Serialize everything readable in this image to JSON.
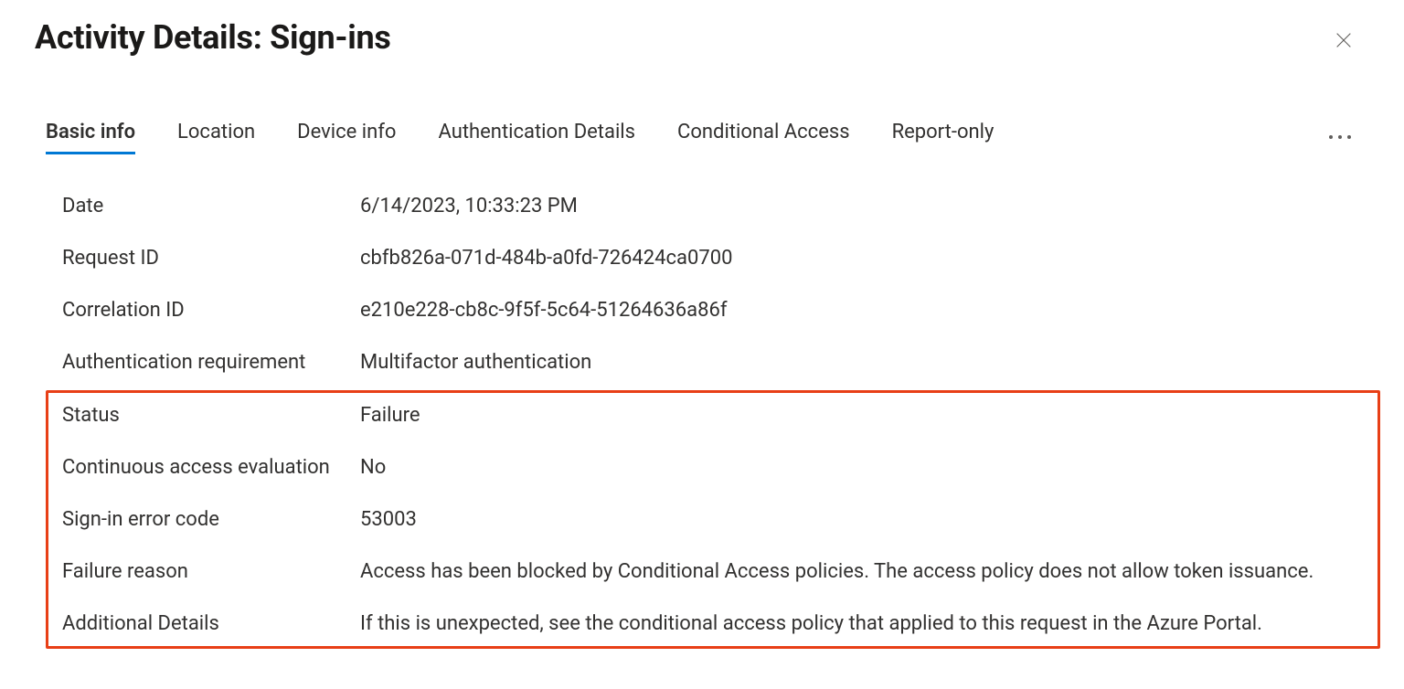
{
  "header": {
    "title": "Activity Details: Sign-ins"
  },
  "tabs": [
    {
      "label": "Basic info",
      "active": true
    },
    {
      "label": "Location",
      "active": false
    },
    {
      "label": "Device info",
      "active": false
    },
    {
      "label": "Authentication Details",
      "active": false
    },
    {
      "label": "Conditional Access",
      "active": false
    },
    {
      "label": "Report-only",
      "active": false
    }
  ],
  "details": {
    "date": {
      "label": "Date",
      "value": "6/14/2023, 10:33:23 PM"
    },
    "request_id": {
      "label": "Request ID",
      "value": "cbfb826a-071d-484b-a0fd-726424ca0700"
    },
    "correlation": {
      "label": "Correlation ID",
      "value": "e210e228-cb8c-9f5f-5c64-51264636a86f"
    },
    "auth_req": {
      "label": "Authentication requirement",
      "value": "Multifactor authentication"
    },
    "status": {
      "label": "Status",
      "value": "Failure"
    },
    "cae": {
      "label": "Continuous access evaluation",
      "value": "No"
    },
    "error_code": {
      "label": "Sign-in error code",
      "value": "53003"
    },
    "fail_reason": {
      "label": "Failure reason",
      "value": "Access has been blocked by Conditional Access policies. The access policy does not allow token issuance."
    },
    "add_details": {
      "label": "Additional Details",
      "value": "If this is unexpected, see the conditional access policy that applied to this request in the Azure Portal."
    }
  }
}
